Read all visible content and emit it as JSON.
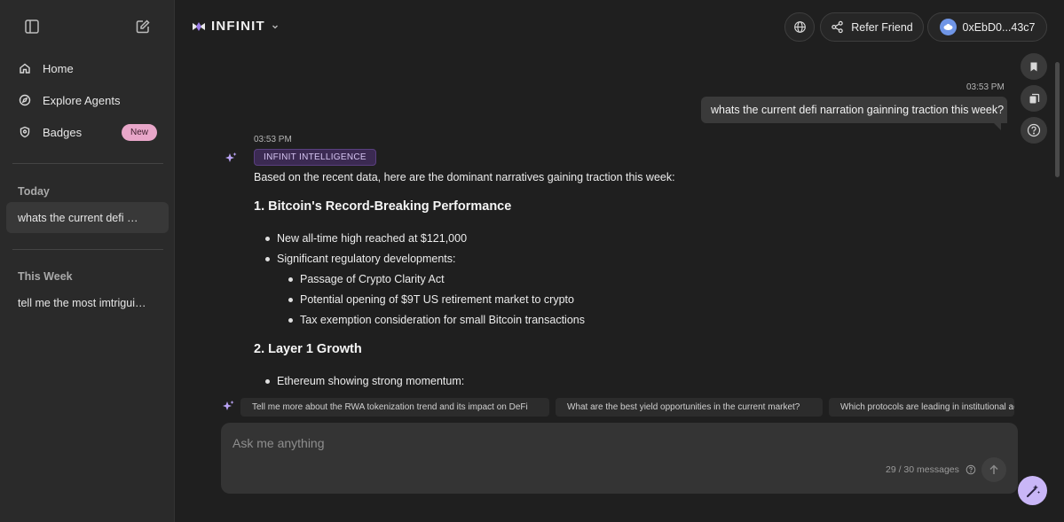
{
  "sidebar": {
    "nav": [
      {
        "label": "Home",
        "icon": "home-icon"
      },
      {
        "label": "Explore Agents",
        "icon": "compass-icon"
      },
      {
        "label": "Badges",
        "icon": "shield-icon",
        "badge": "New"
      }
    ],
    "sections": [
      {
        "title": "Today",
        "items": [
          {
            "label": "whats the current defi narration gainning traction this week?",
            "active": true
          }
        ]
      },
      {
        "title": "This Week",
        "items": [
          {
            "label": "tell me the most imtriguing",
            "active": false
          }
        ]
      }
    ]
  },
  "header": {
    "brand": "INFINIT",
    "refer_label": "Refer Friend",
    "wallet_label": "0xEbD0...43c7"
  },
  "chat": {
    "user_time": "03:53 PM",
    "user_message": "whats the current defi narration gainning traction this week?",
    "ai_time": "03:53 PM",
    "ai_tag": "INFINIT INTELLIGENCE",
    "intro": "Based on the recent data, here are the dominant narratives gaining traction this week:",
    "heading1": "1. Bitcoin's Record-Breaking Performance",
    "b1": "New all-time high reached at $121,000",
    "b2": "Significant regulatory developments:",
    "b2a": "Passage of Crypto Clarity Act",
    "b2b": "Potential opening of $9T US retirement market to crypto",
    "b2c": "Tax exemption consideration for small Bitcoin transactions",
    "heading2": "2. Layer 1 Growth",
    "b3": "Ethereum showing strong momentum:"
  },
  "suggestions": [
    "Tell me more about the RWA tokenization trend and its impact on DeFi",
    "What are the best yield opportunities in the current market?",
    "Which protocols are leading in institutional adoption?"
  ],
  "composer": {
    "placeholder": "Ask me anything",
    "count": "29 / 30 messages"
  },
  "colors": {
    "accent": "#c9b6f7",
    "badge": "#e8a6c9",
    "tag_bg": "#3b2a52"
  }
}
